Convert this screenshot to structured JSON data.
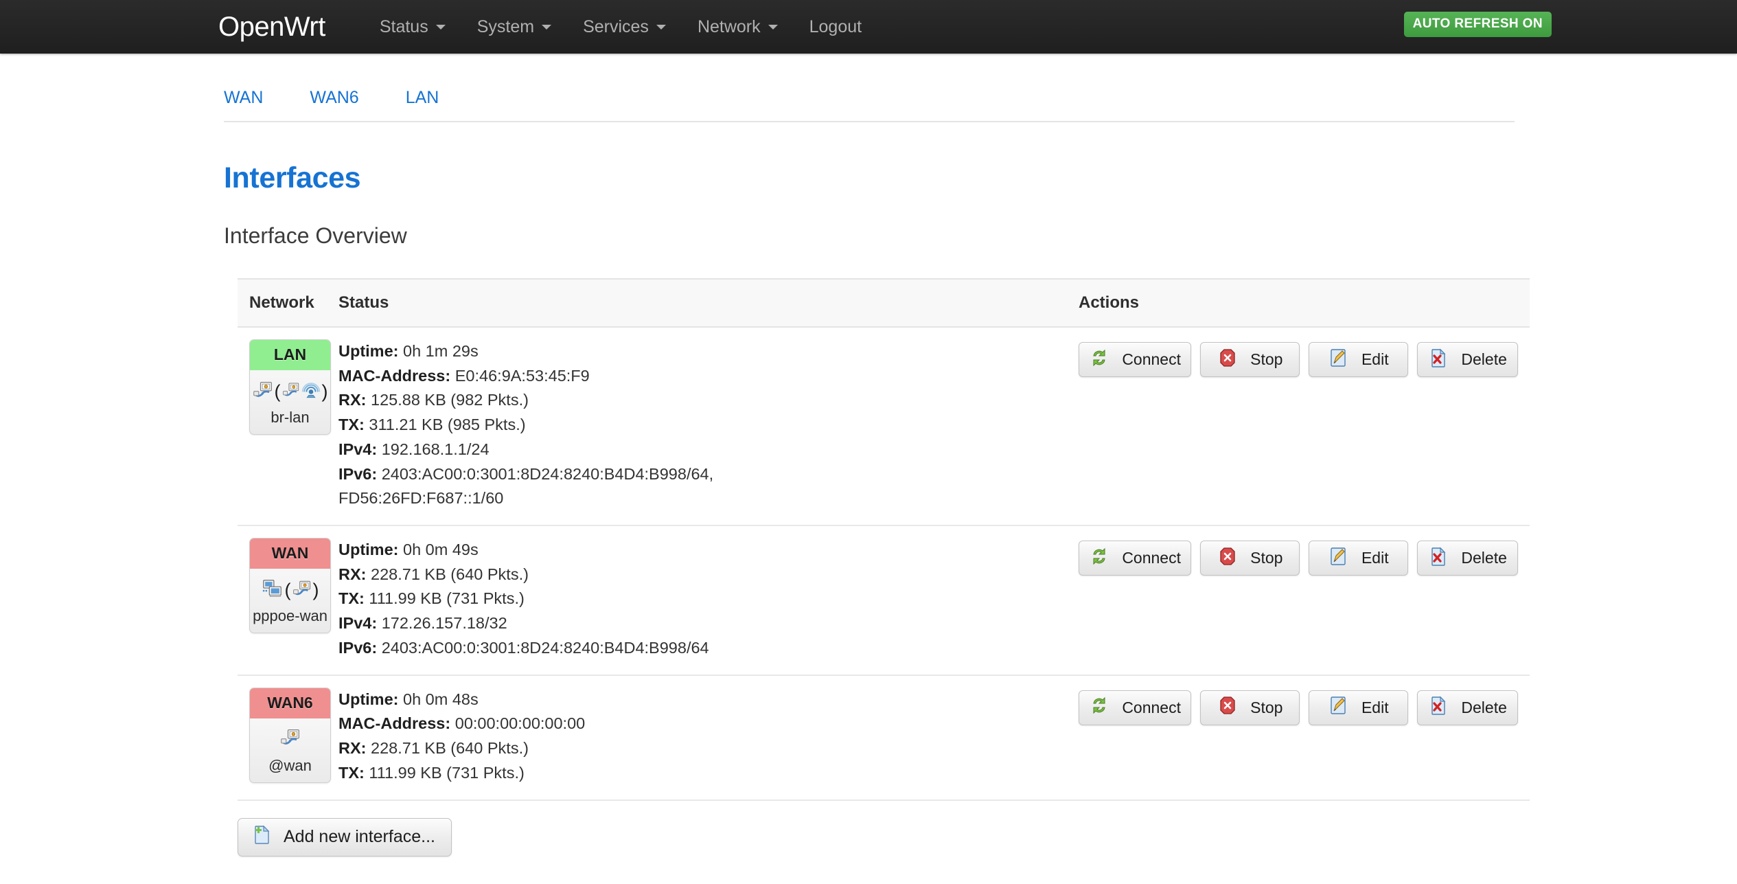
{
  "nav": {
    "brand": "OpenWrt",
    "items": [
      {
        "label": "Status",
        "has_caret": true
      },
      {
        "label": "System",
        "has_caret": true
      },
      {
        "label": "Services",
        "has_caret": true
      },
      {
        "label": "Network",
        "has_caret": true
      },
      {
        "label": "Logout",
        "has_caret": false
      }
    ],
    "refresh_badge": "AUTO REFRESH ON",
    "refresh_badge_color": "#4aa94a",
    "bar_color": "#242424"
  },
  "tabs": [
    {
      "label": "WAN"
    },
    {
      "label": "WAN6"
    },
    {
      "label": "LAN"
    }
  ],
  "page": {
    "title": "Interfaces",
    "title_color": "#1673d3",
    "subtitle": "Interface Overview"
  },
  "table": {
    "headers": {
      "network": "Network",
      "status": "Status",
      "actions": "Actions"
    },
    "rows": [
      {
        "name": "LAN",
        "state": "up",
        "state_color": "#90ee90",
        "device": "br-lan",
        "icons": [
          "ethernet-icon",
          "ethernet-icon",
          "wifi-icon"
        ],
        "status": [
          {
            "label": "Uptime:",
            "value": "0h 1m 29s"
          },
          {
            "label": "MAC-Address:",
            "value": "E0:46:9A:53:45:F9"
          },
          {
            "label": "RX:",
            "value": "125.88 KB (982 Pkts.)"
          },
          {
            "label": "TX:",
            "value": "311.21 KB (985 Pkts.)"
          },
          {
            "label": "IPv4:",
            "value": "192.168.1.1/24"
          },
          {
            "label": "IPv6:",
            "value": "2403:AC00:0:3001:8D24:8240:B4D4:B998/64,"
          },
          {
            "label": "",
            "value": "FD56:26FD:F687::1/60"
          }
        ],
        "actions": [
          "Connect",
          "Stop",
          "Edit",
          "Delete"
        ]
      },
      {
        "name": "WAN",
        "state": "down",
        "state_color": "#f08f8f",
        "device": "pppoe-wan",
        "icons": [
          "network-icon",
          "ethernet-icon"
        ],
        "status": [
          {
            "label": "Uptime:",
            "value": "0h 0m 49s"
          },
          {
            "label": "RX:",
            "value": "228.71 KB (640 Pkts.)"
          },
          {
            "label": "TX:",
            "value": "111.99 KB (731 Pkts.)"
          },
          {
            "label": "IPv4:",
            "value": "172.26.157.18/32"
          },
          {
            "label": "IPv6:",
            "value": "2403:AC00:0:3001:8D24:8240:B4D4:B998/64"
          }
        ],
        "actions": [
          "Connect",
          "Stop",
          "Edit",
          "Delete"
        ]
      },
      {
        "name": "WAN6",
        "state": "down",
        "state_color": "#f08f8f",
        "device": "@wan",
        "icons": [
          "ethernet-icon"
        ],
        "status": [
          {
            "label": "Uptime:",
            "value": "0h 0m 48s"
          },
          {
            "label": "MAC-Address:",
            "value": "00:00:00:00:00:00"
          },
          {
            "label": "RX:",
            "value": "228.71 KB (640 Pkts.)"
          },
          {
            "label": "TX:",
            "value": "111.99 KB (731 Pkts.)"
          }
        ],
        "actions": [
          "Connect",
          "Stop",
          "Edit",
          "Delete"
        ]
      }
    ]
  },
  "footer": {
    "add_interface_label": "Add new interface..."
  }
}
